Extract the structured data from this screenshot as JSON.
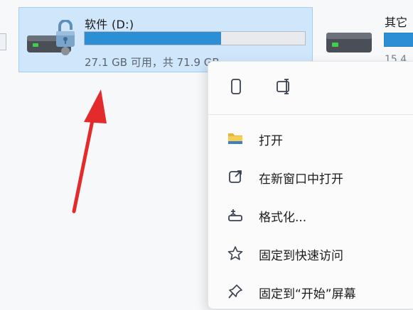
{
  "drive_d": {
    "label": "软件 (D:)",
    "free_text": "27.1 GB 可用，共 71.9 GB",
    "used_fraction": 0.62,
    "icon": "hard-drive-lock-icon"
  },
  "drive_other": {
    "label": "其它",
    "free_text": "15.4",
    "icon": "hard-drive-icon"
  },
  "context_menu": {
    "quick_actions": [
      {
        "name": "copy-icon"
      },
      {
        "name": "rename-icon"
      }
    ],
    "items": [
      {
        "label": "打开",
        "icon": "folder-icon"
      },
      {
        "label": "在新窗口中打开",
        "icon": "open-new-window-icon"
      },
      {
        "label": "格式化...",
        "icon": "format-icon"
      },
      {
        "label": "固定到快速访问",
        "icon": "star-icon"
      },
      {
        "label": "固定到“开始”屏幕",
        "icon": "pin-icon"
      }
    ]
  },
  "colors": {
    "selection_bg": "#cfe6fb",
    "bar_fill": "#2c8fd6",
    "annotation_red": "#e32b2b"
  }
}
